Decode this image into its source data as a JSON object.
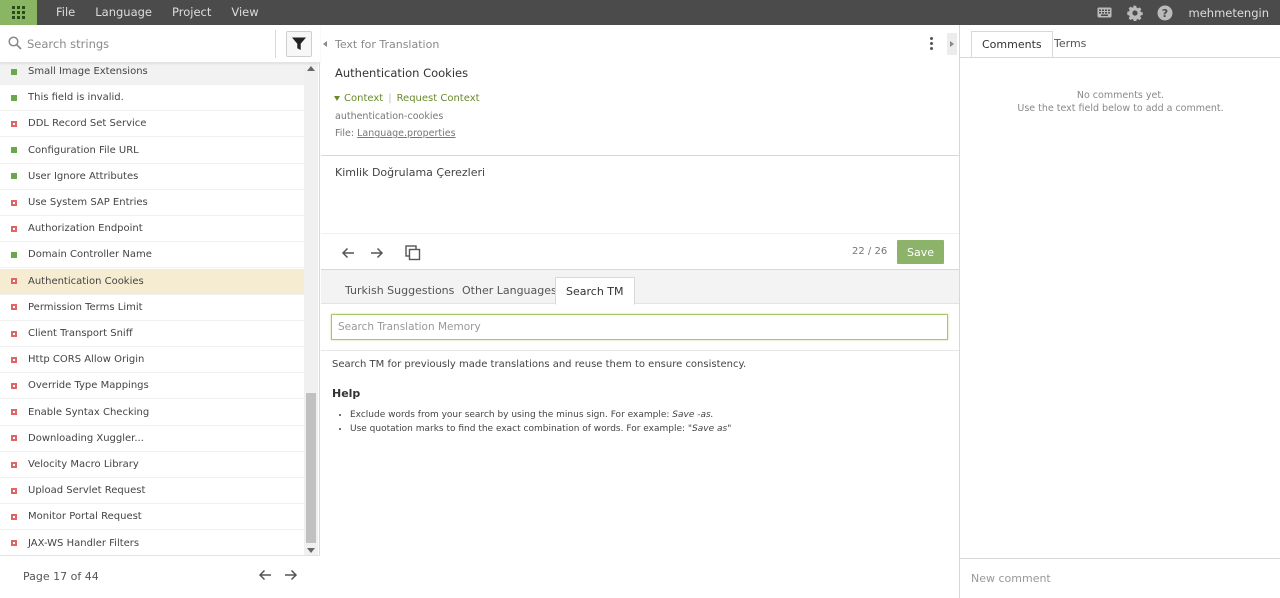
{
  "topbar": {
    "menu": [
      "File",
      "Language",
      "Project",
      "View"
    ],
    "username": "mehmetengin",
    "icons": [
      "apps-grid-icon",
      "keyboard-icon",
      "gear-icon",
      "help-icon"
    ]
  },
  "sidebar": {
    "search_placeholder": "Search strings",
    "items": [
      {
        "label": "Small Image Extensions",
        "status": "translated"
      },
      {
        "label": "This field is invalid.",
        "status": "translated"
      },
      {
        "label": "DDL Record Set Service",
        "status": "untranslated"
      },
      {
        "label": "Configuration File URL",
        "status": "translated"
      },
      {
        "label": "User Ignore Attributes",
        "status": "translated"
      },
      {
        "label": "Use System SAP Entries",
        "status": "untranslated"
      },
      {
        "label": "Authorization Endpoint",
        "status": "untranslated"
      },
      {
        "label": "Domain Controller Name",
        "status": "translated"
      },
      {
        "label": "Authentication Cookies",
        "status": "untranslated"
      },
      {
        "label": "Permission Terms Limit",
        "status": "untranslated"
      },
      {
        "label": "Client Transport Sniff",
        "status": "untranslated"
      },
      {
        "label": "Http CORS Allow Origin",
        "status": "untranslated"
      },
      {
        "label": "Override Type Mappings",
        "status": "untranslated"
      },
      {
        "label": "Enable Syntax Checking",
        "status": "untranslated"
      },
      {
        "label": "Downloading Xuggler...",
        "status": "untranslated"
      },
      {
        "label": "Velocity Macro Library",
        "status": "untranslated"
      },
      {
        "label": "Upload Servlet Request",
        "status": "untranslated"
      },
      {
        "label": "Monitor Portal Request",
        "status": "untranslated"
      },
      {
        "label": "JAX-WS Handler Filters",
        "status": "untranslated"
      }
    ],
    "pager": {
      "text": "Page 17 of 44"
    }
  },
  "editor": {
    "header": "Text for Translation",
    "source_text": "Authentication Cookies",
    "context_label": "Context",
    "request_context_label": "Request Context",
    "context_key": "authentication-cookies",
    "file_label": "File:",
    "file_name": "Language.properties",
    "translation": "Kimlik Doğrulama Çerezleri",
    "counter": "22 / 26",
    "save_label": "Save"
  },
  "suggestions": {
    "tabs": [
      "Turkish Suggestions",
      "Other Languages",
      "Search TM"
    ],
    "active_tab": "Search TM",
    "search_placeholder": "Search Translation Memory",
    "description": "Search TM for previously made translations and reuse them to ensure consistency.",
    "help_title": "Help",
    "help_items": [
      {
        "text": "Exclude words from your search by using the minus sign. For example: ",
        "example": "Save -as."
      },
      {
        "text": "Use quotation marks to find the exact combination of words. For example: ",
        "example": "\"Save as\""
      }
    ]
  },
  "comments": {
    "tabs": [
      "Comments",
      "Terms"
    ],
    "empty_line1": "No comments yet.",
    "empty_line2": "Use the text field below to add a comment.",
    "input_placeholder": "New comment"
  },
  "colors": {
    "accent": "#8db36a",
    "topbar": "#4b4b4b",
    "translated": "#6aa84f",
    "untranslated": "#e06666",
    "selected_row": "#f5ecd1"
  }
}
